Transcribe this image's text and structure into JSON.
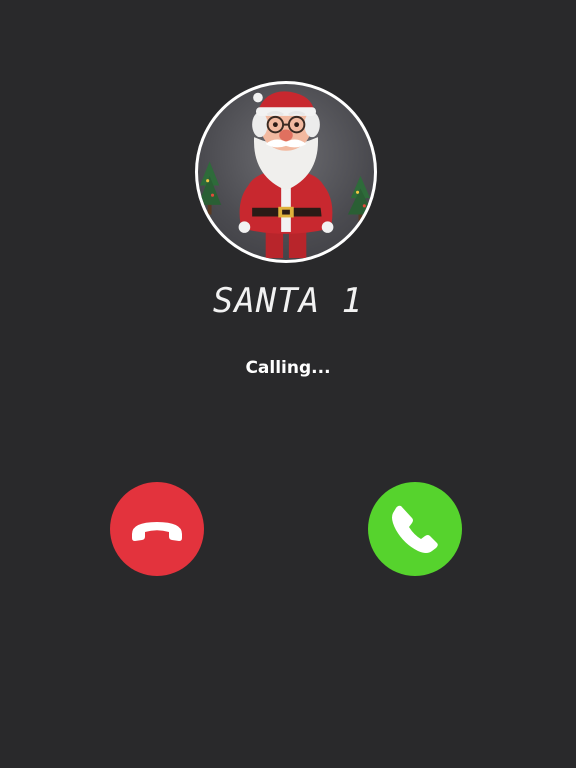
{
  "call": {
    "caller_name": "SANTA 1",
    "status": "Calling..."
  },
  "buttons": {
    "decline": {
      "icon": "phone-hangup-icon",
      "color": "#e3333d"
    },
    "accept": {
      "icon": "phone-icon",
      "color": "#56d32d"
    }
  },
  "colors": {
    "background": "#29292b",
    "text": "#ffffff"
  }
}
